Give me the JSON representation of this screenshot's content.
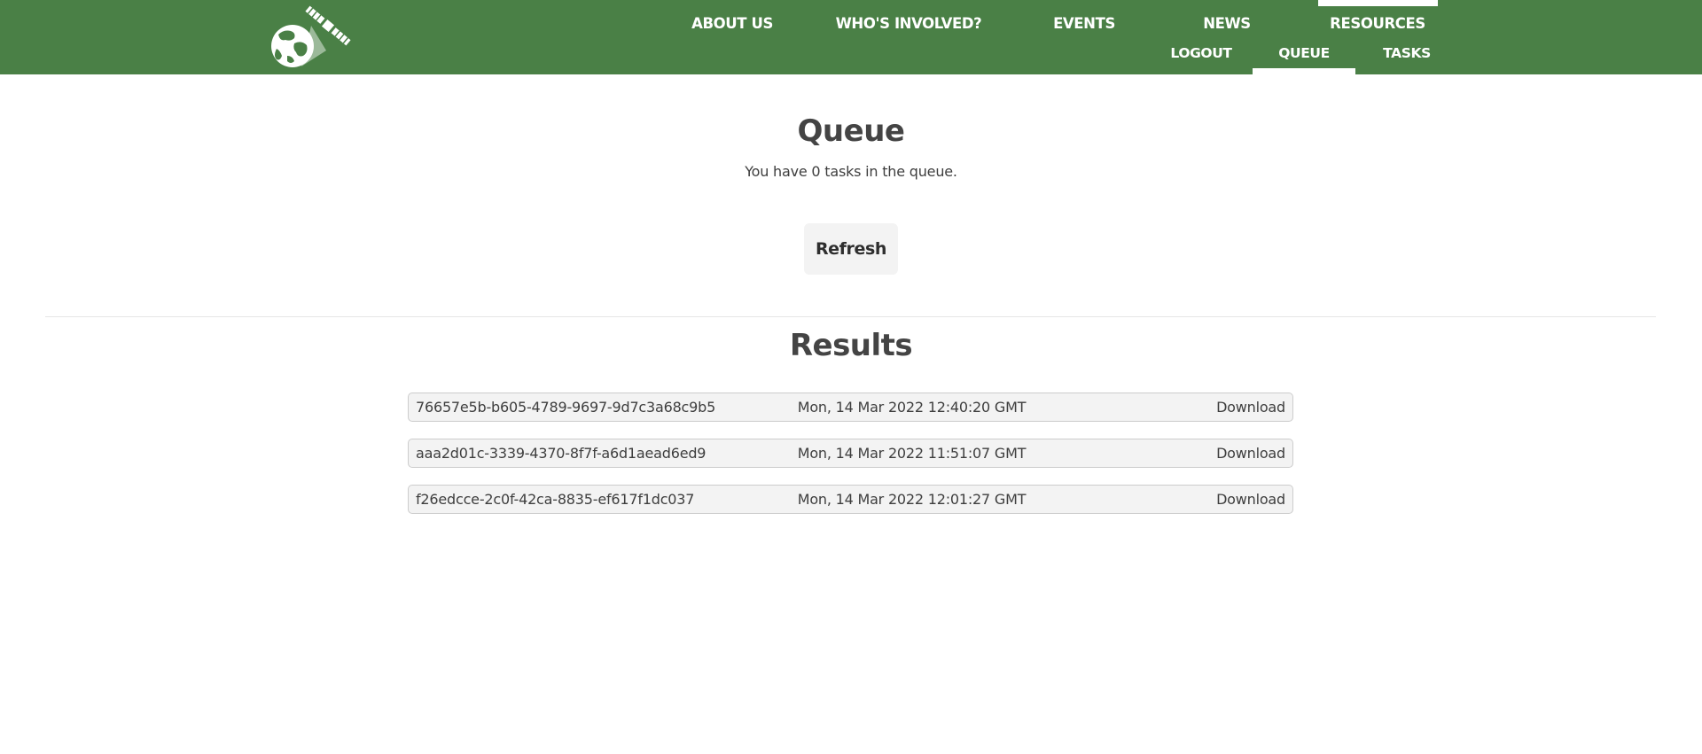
{
  "header": {
    "logo_icon": "globe-satellite-logo-icon",
    "nav_main": [
      {
        "label": "ABOUT US"
      },
      {
        "label": "WHO'S INVOLVED?"
      },
      {
        "label": "EVENTS"
      },
      {
        "label": "NEWS"
      },
      {
        "label": "RESOURCES"
      }
    ],
    "nav_sub": [
      {
        "label": "LOGOUT"
      },
      {
        "label": "QUEUE"
      },
      {
        "label": "TASKS"
      }
    ],
    "colors": {
      "background": "#4a8046",
      "text": "#ffffff"
    }
  },
  "main": {
    "title": "Queue",
    "queue_info": "You have 0 tasks in the queue.",
    "refresh_label": "Refresh"
  },
  "results": {
    "title": "Results",
    "rows": [
      {
        "id": "76657e5b-b605-4789-9697-9d7c3a68c9b5",
        "date": "Mon, 14 Mar 2022 12:40:20 GMT",
        "action": "Download"
      },
      {
        "id": "aaa2d01c-3339-4370-8f7f-a6d1aead6ed9",
        "date": "Mon, 14 Mar 2022 11:51:07 GMT",
        "action": "Download"
      },
      {
        "id": "f26edcce-2c0f-42ca-8835-ef617f1dc037",
        "date": "Mon, 14 Mar 2022 12:01:27 GMT",
        "action": "Download"
      }
    ]
  }
}
